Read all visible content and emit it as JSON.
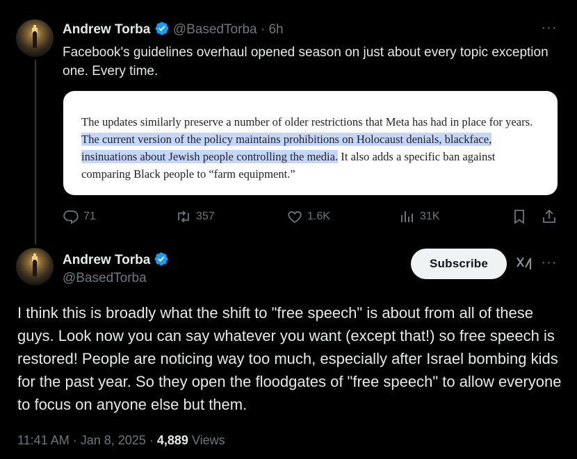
{
  "colors": {
    "background": "#000000",
    "text": "#e7e9ea",
    "muted": "#71767b",
    "verified": "#1d9bf0",
    "highlight": "#c4d6fb"
  },
  "reply_tweet": {
    "author_name": "Andrew Torba",
    "handle": "@BasedTorba",
    "separator": "·",
    "time": "6h",
    "text": "Facebook's guidelines overhaul opened season on just about every topic exception one. Every time.",
    "quote": {
      "before": "The updates similarly preserve a number of older restrictions that Meta has had in place for years. ",
      "highlighted": "The current version of the policy maintains prohibitions on Holocaust denials, blackface, insinuations about Jewish people controlling the media.",
      "after": " It also adds a specific ban against comparing Black people to “farm equipment.”"
    },
    "stats": {
      "replies": "71",
      "reposts": "357",
      "likes": "1.6K",
      "views": "31K"
    }
  },
  "main_tweet": {
    "author_name": "Andrew Torba",
    "handle": "@BasedTorba",
    "subscribe_label": "Subscribe",
    "text": "I think this is broadly what the shift to \"free speech\" is about from all of these guys. Look now you can say whatever you want (except that!) so free speech is restored! People are noticing way too much, especially after Israel bombing kids for the past year. So they open the floodgates of \"free speech\" to allow everyone to focus on anyone else but them.",
    "time": "11:41 AM",
    "date": "Jan 8, 2025",
    "separator": "·",
    "views_count": "4,889",
    "views_label": "Views"
  },
  "icons": [
    "avatar",
    "verified-badge-icon",
    "more-icon",
    "reply-icon",
    "repost-icon",
    "like-icon",
    "views-icon",
    "bookmark-icon",
    "share-icon",
    "grok-icon"
  ]
}
